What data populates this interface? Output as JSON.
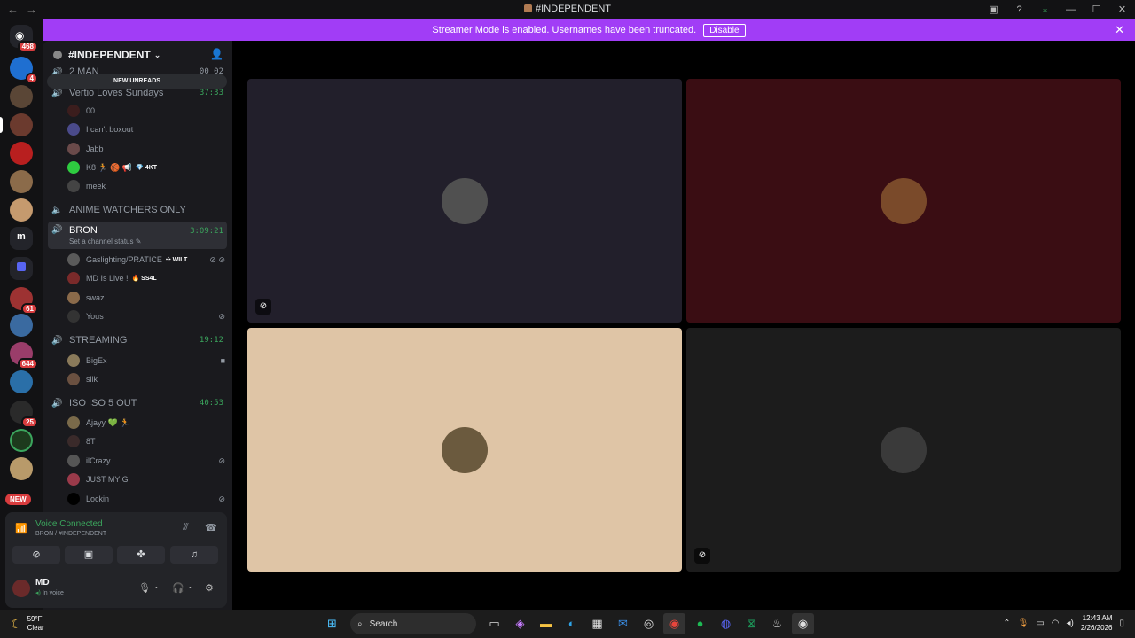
{
  "window": {
    "title": "#INDEPENDENT",
    "back": "←",
    "forward": "→"
  },
  "titlebar_icons": [
    "screen-icon",
    "help-icon",
    "download-icon"
  ],
  "window_controls": {
    "minimize": "—",
    "maximize": "☐",
    "close": "✕"
  },
  "banner": {
    "text": "Streamer Mode is enabled. Usernames have been truncated.",
    "button": "Disable",
    "close": "✕"
  },
  "servers": {
    "home_badge": "468",
    "badges": [
      "4",
      "61",
      "644",
      "25"
    ],
    "new_label": "NEW",
    "m_label": "m"
  },
  "sidebar": {
    "server_name": "#INDEPENDENT",
    "new_unreads": "NEW UNREADS",
    "channels": [
      {
        "name": "2 MAN",
        "time": "00  02"
      },
      {
        "name": "Vertio Loves Sundays",
        "time": "37:33"
      },
      {
        "name": "ANIME WATCHERS ONLY",
        "time": ""
      },
      {
        "name": "BRON",
        "time": "3:09:21",
        "sub": "Set a channel status"
      },
      {
        "name": "STREAMING",
        "time": "19:12"
      },
      {
        "name": "ISO ISO 5 OUT",
        "time": "40:53"
      }
    ],
    "users": {
      "vertio": [
        {
          "name": "00"
        },
        {
          "name": "I can't boxout"
        },
        {
          "name": "Jabb"
        },
        {
          "name": "K8 🏃 🏀 📢",
          "tag": "💎 4KT"
        },
        {
          "name": "meek"
        }
      ],
      "bron": [
        {
          "name": "Gaslighting/PRATICE",
          "tag": "✣ WILT"
        },
        {
          "name": "MD Is Live !",
          "tag": "🔥 SS4L"
        },
        {
          "name": "swaz"
        },
        {
          "name": "Yous"
        }
      ],
      "streaming": [
        {
          "name": "BigEx"
        },
        {
          "name": "silk"
        }
      ],
      "iso": [
        {
          "name": "Ajayy 💚 🏃"
        },
        {
          "name": "8T"
        },
        {
          "name": "ilCrazy"
        },
        {
          "name": "JUST MY G"
        },
        {
          "name": "Lockin"
        }
      ]
    }
  },
  "voice": {
    "title": "Voice Connected",
    "sub": "BRON / #INDEPENDENT"
  },
  "user": {
    "name": "MD",
    "status": "In voice"
  },
  "tiles": [
    {
      "bg": "#221f2b",
      "avatar": "#505050"
    },
    {
      "bg": "#3a0d13",
      "avatar": "#7a4a2a"
    },
    {
      "bg": "#dfc5a6",
      "avatar": "#6b5a3e"
    },
    {
      "bg": "#1c1c1c",
      "avatar": "#3a3a3a"
    }
  ],
  "taskbar": {
    "temp": "59°F",
    "condition": "Clear",
    "search": "Search",
    "time": "12:43 AM",
    "date": "2/26/2026"
  }
}
